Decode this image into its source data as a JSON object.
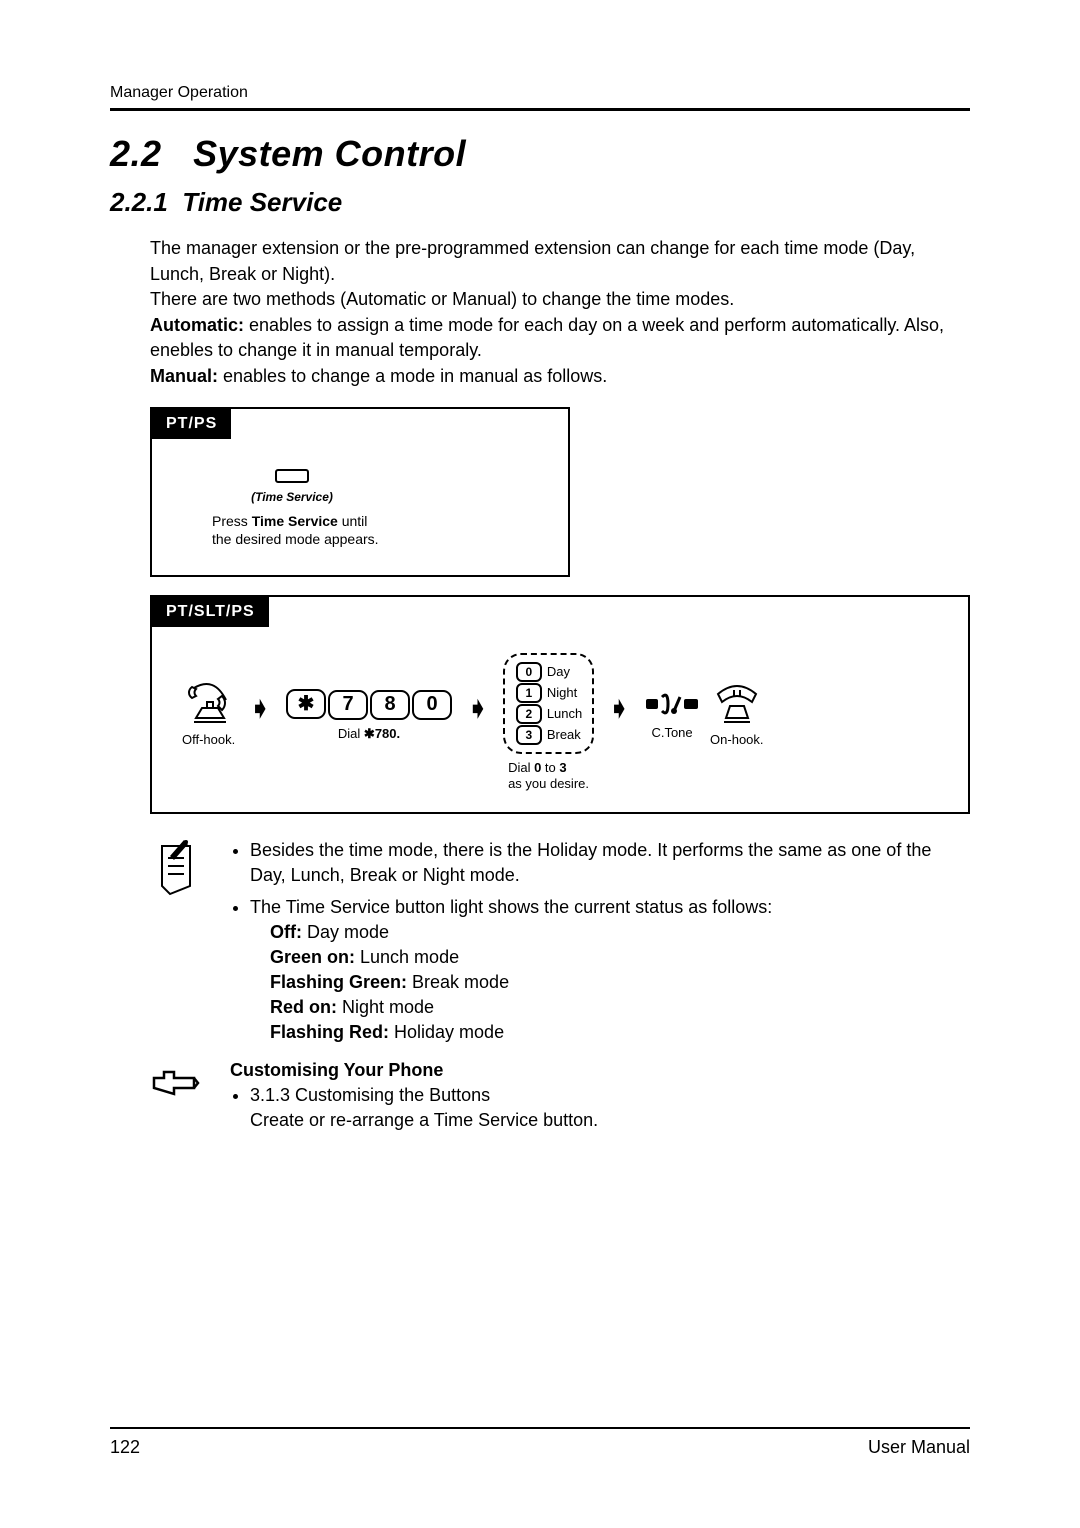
{
  "header": {
    "breadcrumb": "Manager Operation"
  },
  "section": {
    "number": "2.2",
    "title": "System Control",
    "sub_number": "2.2.1",
    "sub_title": "Time Service"
  },
  "intro": {
    "p1": "The manager extension or the pre-programmed extension can change for each time mode (Day, Lunch, Break or Night).",
    "p2": "There are two methods (Automatic or Manual) to change the time modes.",
    "auto_label": "Automatic:",
    "auto_text": " enables to assign a time mode for each day on a week and perform automatically. Also, enebles to change it in manual temporaly.",
    "manual_label": "Manual:",
    "manual_text": " enables to change a mode in manual as follows."
  },
  "ptps": {
    "tab": "PT/PS",
    "button_label": "(Time Service)",
    "caption_pre": "Press ",
    "caption_strong": "Time Service",
    "caption_post": " until the desired mode appears."
  },
  "ptslt": {
    "tab": "PT/SLT/PS",
    "offhook": "Off-hook.",
    "dial_pre": "Dial ",
    "dial_code": "780.",
    "star": "✱",
    "keys": [
      "7",
      "8",
      "0"
    ],
    "options": [
      {
        "k": "0",
        "label": "Day"
      },
      {
        "k": "1",
        "label": "Night"
      },
      {
        "k": "2",
        "label": "Lunch"
      },
      {
        "k": "3",
        "label": "Break"
      }
    ],
    "dial2_pre": "Dial ",
    "dial2_b1": "0",
    "dial2_mid": " to ",
    "dial2_b2": "3",
    "dial2_post": " as you desire.",
    "ctone": "C.Tone",
    "onhook": "On-hook."
  },
  "notes": {
    "bullet1": "Besides the time mode, there is the Holiday mode. It performs the same as one of the Day, Lunch, Break or Night mode.",
    "bullet2": "The Time Service button light shows the current status as follows:",
    "states": [
      {
        "k": "Off:",
        "v": " Day mode"
      },
      {
        "k": "Green on:",
        "v": " Lunch mode"
      },
      {
        "k": "Flashing Green:",
        "v": " Break mode"
      },
      {
        "k": "Red on:",
        "v": " Night mode"
      },
      {
        "k": "Flashing Red:",
        "v": " Holiday mode"
      }
    ]
  },
  "custom": {
    "heading": "Customising Your Phone",
    "ref": "3.1.3   Customising the Buttons",
    "desc": "Create or re-arrange a Time Service button."
  },
  "footer": {
    "page": "122",
    "title": "User Manual"
  }
}
